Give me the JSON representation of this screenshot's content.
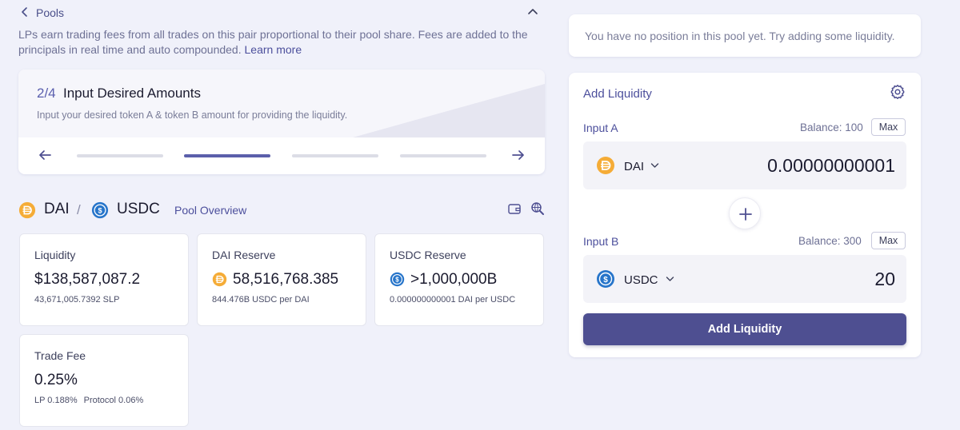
{
  "header": {
    "pools_label": "Pools",
    "description": "LPs earn trading fees from all trades on this pair proportional to their pool share. Fees are added to the principals in real time and auto compounded.",
    "learn_more": "Learn more"
  },
  "stepper": {
    "step_number": "2/4",
    "title": "Input Desired Amounts",
    "subtitle": "Input your desired token A & token B amount for providing the liquidity.",
    "total_steps": 4,
    "current_step": 2
  },
  "pair": {
    "token_a": "DAI",
    "separator": "/",
    "token_b": "USDC",
    "overview_link": "Pool Overview"
  },
  "stats": {
    "liquidity": {
      "label": "Liquidity",
      "value": "$138,587,087.2",
      "sub": "43,671,005.7392 SLP"
    },
    "dai_reserve": {
      "label": "DAI Reserve",
      "value": "58,516,768.385",
      "sub": "844.476B USDC per DAI"
    },
    "usdc_reserve": {
      "label": "USDC Reserve",
      "value": ">1,000,000B",
      "sub": "0.000000000001 DAI per USDC"
    },
    "trade_fee": {
      "label": "Trade Fee",
      "value": "0.25%",
      "lp": "LP 0.188%",
      "protocol": "Protocol 0.06%"
    }
  },
  "notice": {
    "text": "You have no position in this pool yet. Try adding some liquidity."
  },
  "add_liquidity": {
    "title": "Add Liquidity",
    "input_a": {
      "label": "Input A",
      "balance": "Balance: 100",
      "max_label": "Max",
      "token": "DAI",
      "amount": "0.00000000001"
    },
    "input_b": {
      "label": "Input B",
      "balance": "Balance: 300",
      "max_label": "Max",
      "token": "USDC",
      "amount": "20"
    },
    "submit_label": "Add Liquidity"
  },
  "icons": {
    "back": "chevron-left-icon",
    "collapse": "chevron-up-icon",
    "dai": "dai-token-icon",
    "usdc": "usdc-token-icon",
    "wallet": "wallet-icon",
    "explorer": "search-globe-icon",
    "settings": "gear-icon",
    "plus": "plus-icon"
  },
  "colors": {
    "accent": "#4e4f91",
    "link": "#4c4f9c",
    "dai": "#f5ac37",
    "usdc": "#2775ca"
  }
}
